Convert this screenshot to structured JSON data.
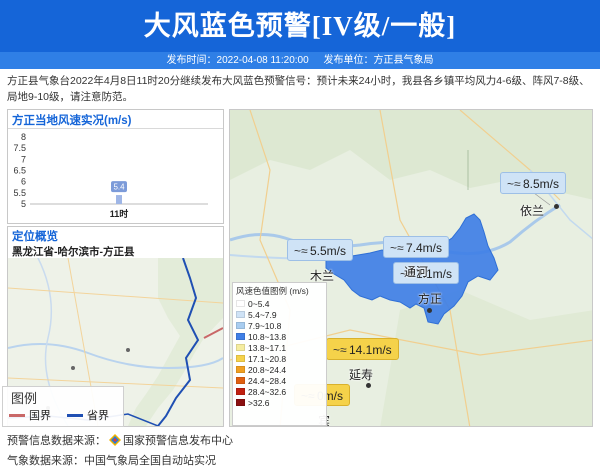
{
  "header": {
    "title": "大风蓝色预警[IV级/一般]"
  },
  "subbar": {
    "publish_time": "发布时间：2022-04-08 11:20:00",
    "publish_unit": "发布单位：方正县气象局"
  },
  "notice": {
    "text": "方正县气象台2022年4月8日11时20分继续发布大风蓝色预警信号：预计未来24小时，我县各乡镇平均风力4-6级、阵风7-8级、局地9-10级，请注意防范。"
  },
  "wind_panel": {
    "title": "方正当地风速实况(m/s)"
  },
  "chart_data": {
    "type": "bar",
    "title": "方正当地风速实况(m/s)",
    "categories": [
      "11时"
    ],
    "values": [
      5.4
    ],
    "data_labels": [
      "5.4"
    ],
    "y_ticks": [
      "8",
      "7.5",
      "7",
      "6.5",
      "6",
      "5.5",
      "5"
    ],
    "ylim": [
      5,
      8
    ],
    "xlabel": "",
    "ylabel": "",
    "bar_color": "#9fb6e6",
    "label_color": "#7c9bd9"
  },
  "location_panel": {
    "title": "定位概览",
    "subtitle": "黑龙江省-哈尔滨市-方正县",
    "legend": {
      "title": "图例",
      "items": [
        {
          "label": "国界",
          "color": "#c96868"
        },
        {
          "label": "省界",
          "color": "#1f4fb3"
        }
      ]
    }
  },
  "main_map": {
    "legend": {
      "title": "风速色值图例 (m/s)",
      "items": [
        {
          "label": "0~5.4",
          "color": "#ffffff"
        },
        {
          "label": "5.4~7.9",
          "color": "#cfe3f6"
        },
        {
          "label": "7.9~10.8",
          "color": "#a8cdf0"
        },
        {
          "label": "10.8~13.8",
          "color": "#3f7fe6"
        },
        {
          "label": "13.8~17.1",
          "color": "#f5eda0"
        },
        {
          "label": "17.1~20.8",
          "color": "#f5d24a"
        },
        {
          "label": "20.8~24.4",
          "color": "#f0a020"
        },
        {
          "label": "24.4~28.4",
          "color": "#e06010"
        },
        {
          "label": "28.4~32.6",
          "color": "#c02010"
        },
        {
          "label": ">32.6",
          "color": "#8a1010"
        }
      ]
    },
    "wind_labels": [
      {
        "text": "8.5m/s",
        "color": "#cfe3f6"
      },
      {
        "text": "5.5m/s",
        "color": "#cfe3f6"
      },
      {
        "text": "7.4m/s",
        "color": "#cfe3f6"
      },
      {
        "text": "1.1m/s",
        "color": "#cfe3f6"
      },
      {
        "text": "14.1m/s",
        "color": "#f5d24a"
      },
      {
        "text": "0m/s",
        "color": "#f5d24a"
      }
    ],
    "wind_icon": "wind-icon",
    "towns": [
      "依兰",
      "木兰",
      "通河",
      "方正",
      "延寿",
      "宾"
    ]
  },
  "footer": {
    "warning_source": "预警信息数据来源：",
    "warning_source_name": "国家预警信息发布中心",
    "weather_source": "气象数据来源：中国气象局全国自动站实况"
  }
}
